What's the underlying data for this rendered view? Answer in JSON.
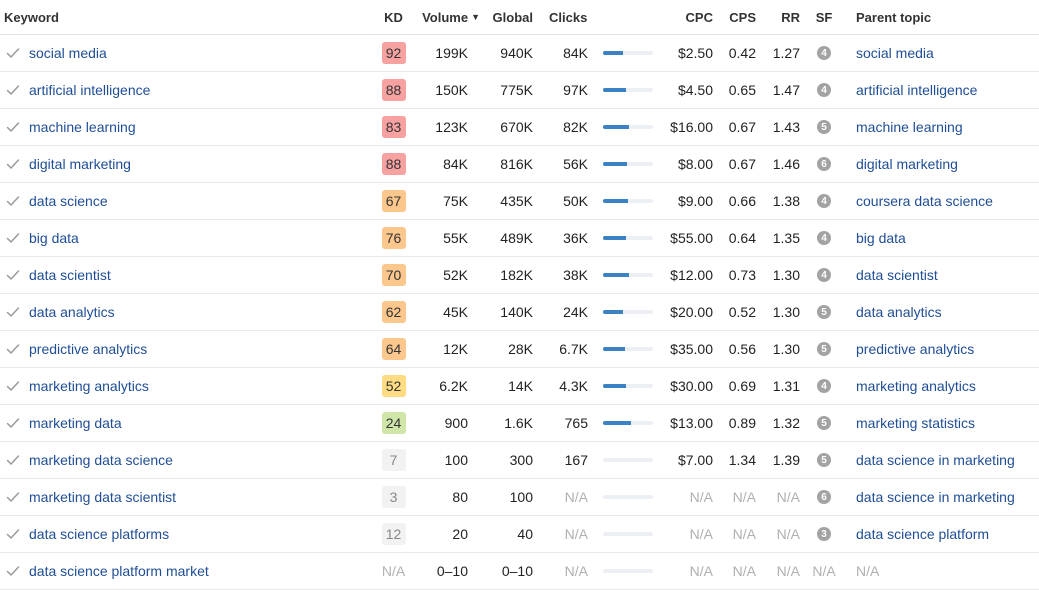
{
  "columns": {
    "keyword": "Keyword",
    "kd": "KD",
    "volume": "Volume",
    "global": "Global",
    "clicks": "Clicks",
    "cpc": "CPC",
    "cps": "CPS",
    "rr": "RR",
    "sf": "SF",
    "parent_topic": "Parent topic"
  },
  "sort": {
    "column": "volume",
    "direction": "desc",
    "indicator": "▼"
  },
  "kd_colors": {
    "red": "#f7a1a1",
    "orange": "#fbc78d",
    "yellow": "#fddc84",
    "green": "#cfe6a8",
    "gray": "#f2f2f2"
  },
  "rows": [
    {
      "keyword": "social media",
      "kd": "92",
      "kd_level": "red",
      "volume": "199K",
      "global": "940K",
      "clicks": "84K",
      "clicks_bar": 0.4,
      "cpc": "$2.50",
      "cps": "0.42",
      "rr": "1.27",
      "sf": "4",
      "parent_topic": "social media"
    },
    {
      "keyword": "artificial intelligence",
      "kd": "88",
      "kd_level": "red",
      "volume": "150K",
      "global": "775K",
      "clicks": "97K",
      "clicks_bar": 0.46,
      "cpc": "$4.50",
      "cps": "0.65",
      "rr": "1.47",
      "sf": "4",
      "parent_topic": "artificial intelligence"
    },
    {
      "keyword": "machine learning",
      "kd": "83",
      "kd_level": "red",
      "volume": "123K",
      "global": "670K",
      "clicks": "82K",
      "clicks_bar": 0.52,
      "cpc": "$16.00",
      "cps": "0.67",
      "rr": "1.43",
      "sf": "5",
      "parent_topic": "machine learning"
    },
    {
      "keyword": "digital marketing",
      "kd": "88",
      "kd_level": "red",
      "volume": "84K",
      "global": "816K",
      "clicks": "56K",
      "clicks_bar": 0.48,
      "cpc": "$8.00",
      "cps": "0.67",
      "rr": "1.46",
      "sf": "6",
      "parent_topic": "digital marketing"
    },
    {
      "keyword": "data science",
      "kd": "67",
      "kd_level": "orange",
      "volume": "75K",
      "global": "435K",
      "clicks": "50K",
      "clicks_bar": 0.5,
      "cpc": "$9.00",
      "cps": "0.66",
      "rr": "1.38",
      "sf": "4",
      "parent_topic": "coursera data science"
    },
    {
      "keyword": "big data",
      "kd": "76",
      "kd_level": "orange",
      "volume": "55K",
      "global": "489K",
      "clicks": "36K",
      "clicks_bar": 0.46,
      "cpc": "$55.00",
      "cps": "0.64",
      "rr": "1.35",
      "sf": "4",
      "parent_topic": "big data"
    },
    {
      "keyword": "data scientist",
      "kd": "70",
      "kd_level": "orange",
      "volume": "52K",
      "global": "182K",
      "clicks": "38K",
      "clicks_bar": 0.52,
      "cpc": "$12.00",
      "cps": "0.73",
      "rr": "1.30",
      "sf": "4",
      "parent_topic": "data scientist"
    },
    {
      "keyword": "data analytics",
      "kd": "62",
      "kd_level": "orange",
      "volume": "45K",
      "global": "140K",
      "clicks": "24K",
      "clicks_bar": 0.4,
      "cpc": "$20.00",
      "cps": "0.52",
      "rr": "1.30",
      "sf": "5",
      "parent_topic": "data analytics"
    },
    {
      "keyword": "predictive analytics",
      "kd": "64",
      "kd_level": "orange",
      "volume": "12K",
      "global": "28K",
      "clicks": "6.7K",
      "clicks_bar": 0.44,
      "cpc": "$35.00",
      "cps": "0.56",
      "rr": "1.30",
      "sf": "5",
      "parent_topic": "predictive analytics"
    },
    {
      "keyword": "marketing analytics",
      "kd": "52",
      "kd_level": "yellow",
      "volume": "6.2K",
      "global": "14K",
      "clicks": "4.3K",
      "clicks_bar": 0.46,
      "cpc": "$30.00",
      "cps": "0.69",
      "rr": "1.31",
      "sf": "4",
      "parent_topic": "marketing analytics"
    },
    {
      "keyword": "marketing data",
      "kd": "24",
      "kd_level": "green",
      "volume": "900",
      "global": "1.6K",
      "clicks": "765",
      "clicks_bar": 0.56,
      "cpc": "$13.00",
      "cps": "0.89",
      "rr": "1.32",
      "sf": "5",
      "parent_topic": "marketing statistics"
    },
    {
      "keyword": "marketing data science",
      "kd": "7",
      "kd_level": "gray",
      "volume": "100",
      "global": "300",
      "clicks": "167",
      "clicks_bar": 0,
      "cpc": "$7.00",
      "cps": "1.34",
      "rr": "1.39",
      "sf": "5",
      "parent_topic": "data science in marketing"
    },
    {
      "keyword": "marketing data scientist",
      "kd": "3",
      "kd_level": "gray",
      "volume": "80",
      "global": "100",
      "clicks": "N/A",
      "clicks_bar": 0,
      "cpc": "N/A",
      "cps": "N/A",
      "rr": "N/A",
      "sf": "6",
      "parent_topic": "data science in marketing"
    },
    {
      "keyword": "data science platforms",
      "kd": "12",
      "kd_level": "gray",
      "volume": "20",
      "global": "40",
      "clicks": "N/A",
      "clicks_bar": 0,
      "cpc": "N/A",
      "cps": "N/A",
      "rr": "N/A",
      "sf": "3",
      "parent_topic": "data science platform"
    },
    {
      "keyword": "data science platform market",
      "kd": "N/A",
      "kd_level": "none",
      "volume": "0–10",
      "global": "0–10",
      "clicks": "N/A",
      "clicks_bar": 0,
      "cpc": "N/A",
      "cps": "N/A",
      "rr": "N/A",
      "sf": "N/A",
      "parent_topic": "N/A"
    }
  ]
}
